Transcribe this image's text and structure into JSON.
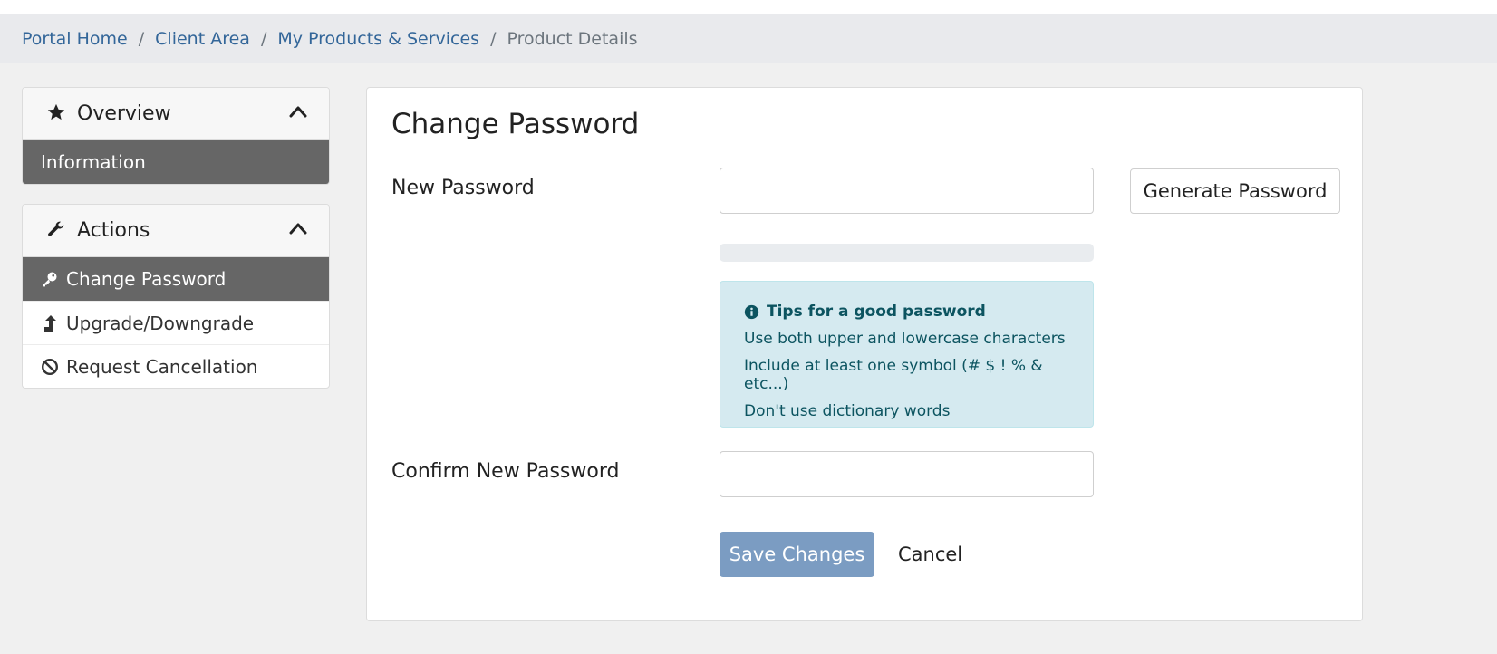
{
  "breadcrumb": {
    "items": [
      {
        "label": "Portal Home"
      },
      {
        "label": "Client Area"
      },
      {
        "label": "My Products & Services"
      }
    ],
    "current": "Product Details",
    "separator": "/"
  },
  "sidebar": {
    "overview": {
      "title": "Overview",
      "items": [
        {
          "label": "Information",
          "active": true
        }
      ]
    },
    "actions": {
      "title": "Actions",
      "items": [
        {
          "label": "Change Password",
          "icon": "key-icon",
          "active": true
        },
        {
          "label": "Upgrade/Downgrade",
          "icon": "arrow-up-icon",
          "active": false
        },
        {
          "label": "Request Cancellation",
          "icon": "ban-icon",
          "active": false
        }
      ]
    }
  },
  "form": {
    "title": "Change Password",
    "new_password_label": "New Password",
    "new_password_value": "",
    "generate_button": "Generate Password",
    "strength_percent": 0,
    "tips": {
      "title": "Tips for a good password",
      "lines": [
        "Use both upper and lowercase characters",
        "Include at least one symbol (# $ ! % & etc...)",
        "Don't use dictionary words"
      ]
    },
    "confirm_label": "Confirm New Password",
    "confirm_value": "",
    "save_button": "Save Changes",
    "cancel_button": "Cancel"
  },
  "colors": {
    "link": "#336699",
    "active_nav": "#666666",
    "save_button": "#7b9cc2",
    "tips_bg": "#d5eaf0",
    "tips_text": "#0c5460"
  }
}
